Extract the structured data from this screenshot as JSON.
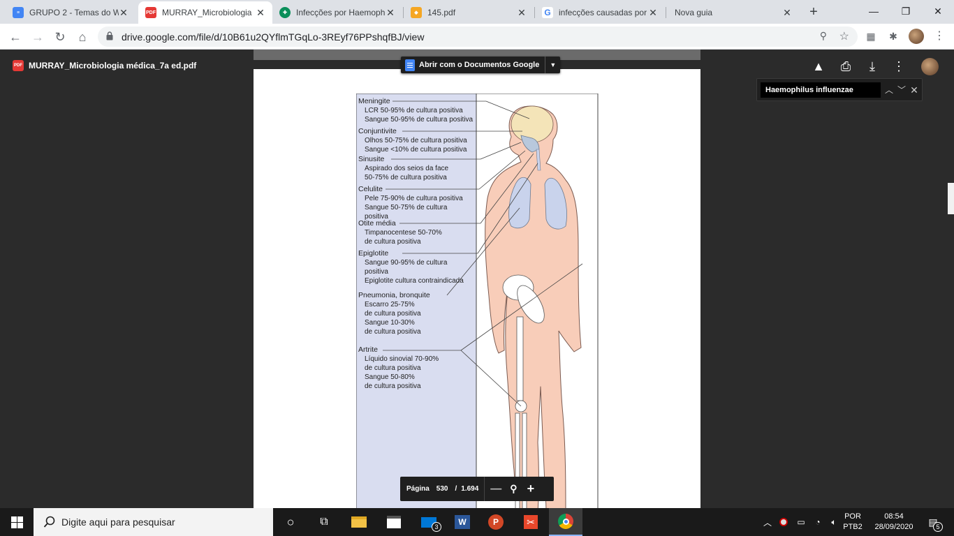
{
  "browser": {
    "tabs": [
      {
        "title": "GRUPO 2 - Temas do W",
        "favicon": "google-docs-icon",
        "active": false
      },
      {
        "title": "MURRAY_Microbiologia",
        "favicon": "pdf-icon",
        "active": true
      },
      {
        "title": "Infecções por Haemoph",
        "favicon": "medical-site-icon",
        "active": false
      },
      {
        "title": "145.pdf",
        "favicon": "shield-icon",
        "active": false
      },
      {
        "title": "infecções causadas por",
        "favicon": "google-icon",
        "active": false
      },
      {
        "title": "Nova guia",
        "favicon": "",
        "active": false
      }
    ],
    "new_tab": "+",
    "url": "drive.google.com/file/d/10B61u2QYflmTGqLo-3REyf76PPshqfBJ/view"
  },
  "viewer": {
    "file_title": "MURRAY_Microbiologia médica_7a ed.pdf",
    "file_icon_label": "PDF",
    "open_with_label": "Abrir com o Documentos Google",
    "search_text": "Haemophilus influenzae",
    "page_label": "Página",
    "page_current": "530",
    "page_sep": "/",
    "page_total": "1.694"
  },
  "figure": {
    "items": [
      {
        "title": "Meningite",
        "lines": [
          "LCR 50-95% de cultura positiva",
          "Sangue 50-95% de cultura positiva"
        ]
      },
      {
        "title": "Conjuntivite",
        "lines": [
          "Olhos 50-75% de cultura positiva",
          "Sangue <10% de cultura positiva"
        ]
      },
      {
        "title": "Sinusite",
        "lines": [
          "Aspirado dos seios da face",
          "50-75% de cultura positiva"
        ]
      },
      {
        "title": "Celulite",
        "lines": [
          "Pele 75-90% de cultura positiva",
          "Sangue 50-75% de cultura",
          "positiva"
        ]
      },
      {
        "title": "Otite média",
        "lines": [
          "Timpanocentese 50-70%",
          "de cultura positiva"
        ]
      },
      {
        "title": "Epiglotite",
        "lines": [
          "Sangue 90-95% de cultura",
          "positiva",
          "Epiglotite cultura contraindicada"
        ]
      },
      {
        "title": "Pneumonia, bronquite",
        "lines": [
          "Escarro 25-75%",
          "de cultura positiva",
          "Sangue 10-30%",
          "de cultura positiva"
        ]
      },
      {
        "title": "Artrite",
        "lines": [
          "Líquido sinovial 70-90%",
          "de cultura positiva",
          "Sangue 50-80%",
          "de cultura positiva"
        ]
      }
    ]
  },
  "taskbar": {
    "search_placeholder": "Digite aqui para pesquisar",
    "mail_badge": "3",
    "lang_top": "POR",
    "lang_bottom": "PTB2",
    "time": "08:54",
    "date": "28/09/2020",
    "notif_count": "5"
  },
  "colors": {
    "panel_blue": "#d9ddf0",
    "skin": "#f8cdb9",
    "lung": "#c9d3ec",
    "drive_dark": "#2b2b2b",
    "pdf_red": "#e53935"
  }
}
